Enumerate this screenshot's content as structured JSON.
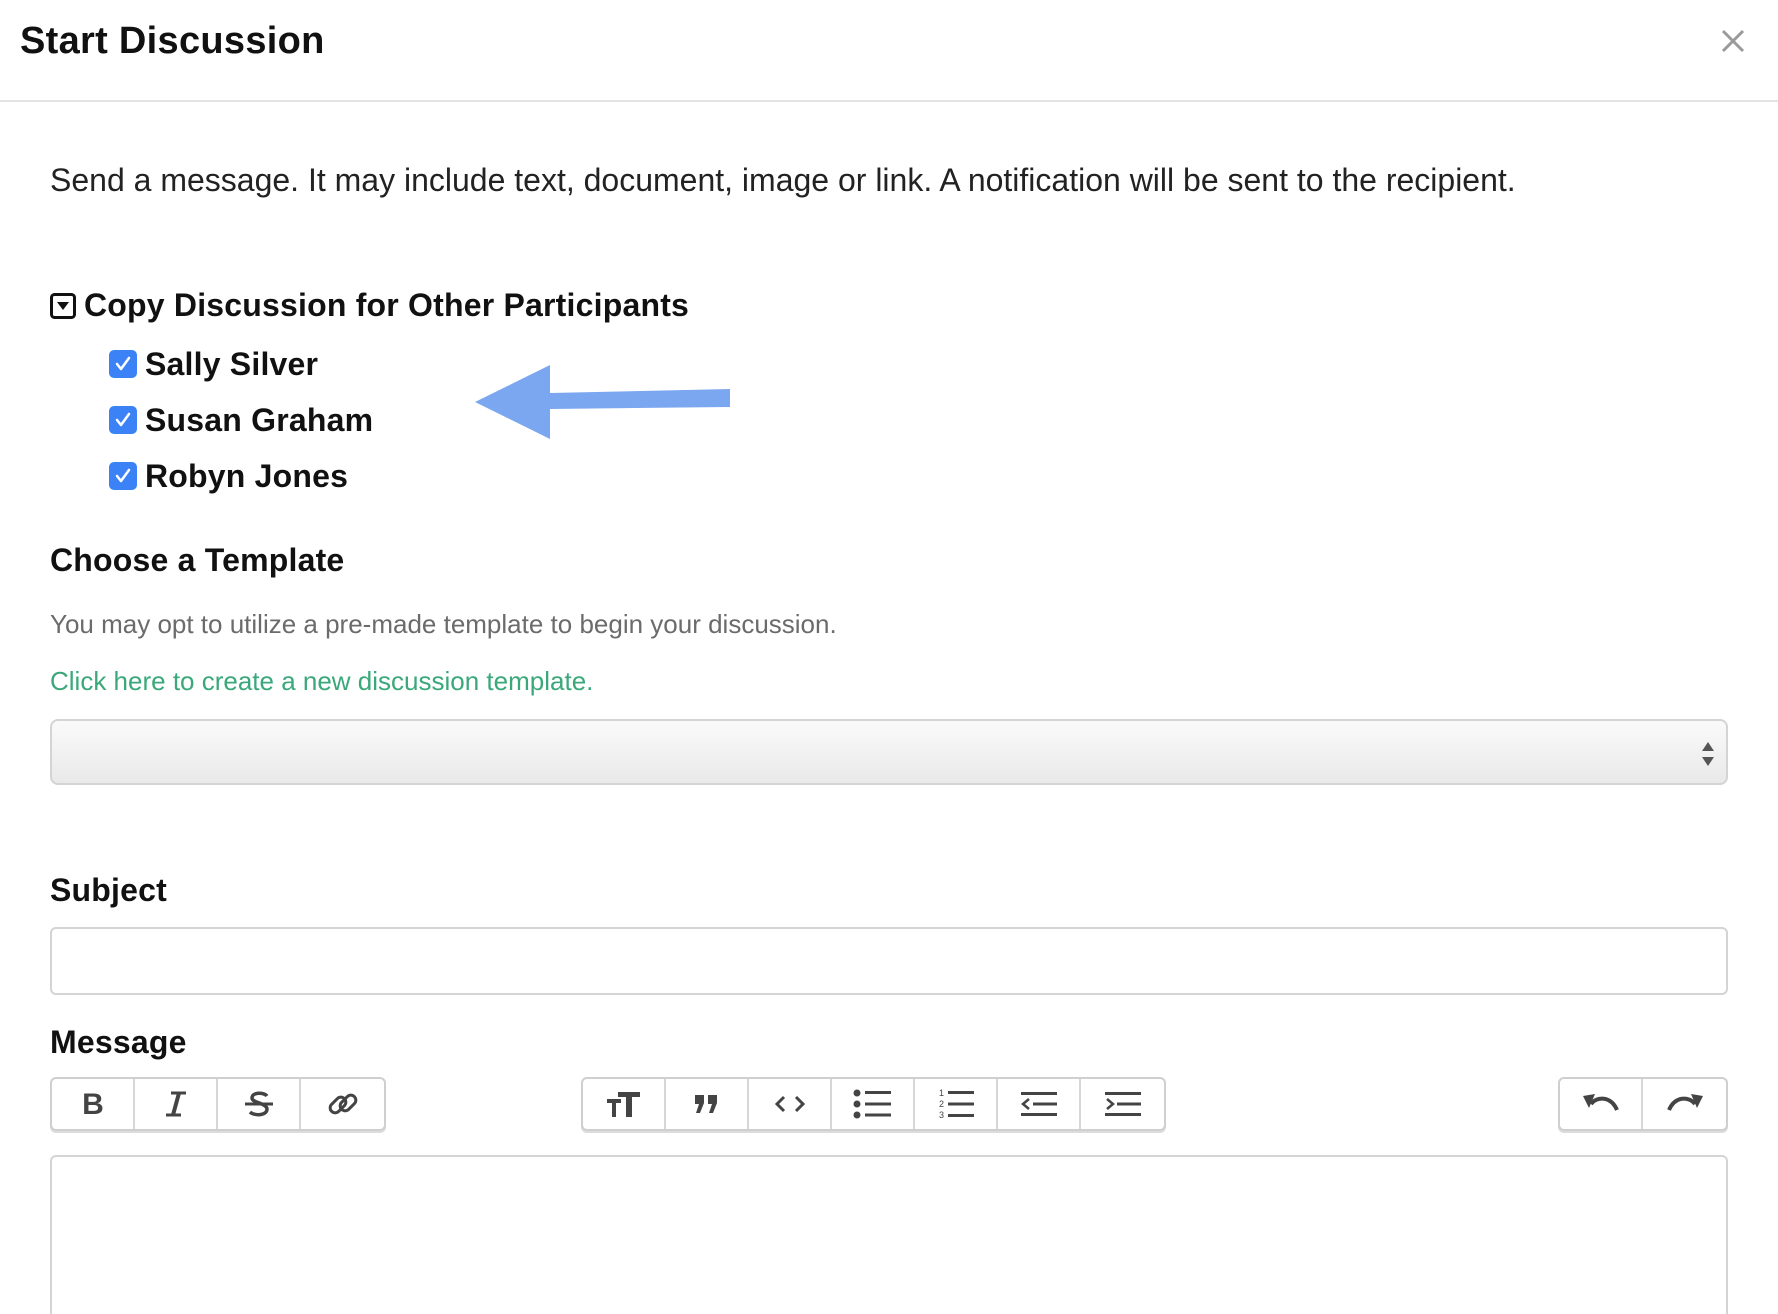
{
  "dialog": {
    "title": "Start Discussion",
    "close_icon": "close-icon"
  },
  "intro_text": "Send a message. It may include text, document, image or link. A notification will be sent to the recipient.",
  "copy_section": {
    "title": "Copy Discussion for Other Participants",
    "toggle_icon": "collapse-toggle-icon",
    "participants": [
      {
        "name": "Sally Silver",
        "checked": true
      },
      {
        "name": "Susan Graham",
        "checked": true
      },
      {
        "name": "Robyn Jones",
        "checked": true
      }
    ]
  },
  "annotation": {
    "icon": "arrow-left-icon",
    "color": "#7ba7f0"
  },
  "template": {
    "heading": "Choose a Template",
    "description": "You may opt to utilize a pre-made template to begin your discussion.",
    "link_text": "Click here to create a new discussion template.",
    "selected_value": ""
  },
  "subject": {
    "label": "Subject",
    "value": "",
    "placeholder": ""
  },
  "message": {
    "label": "Message",
    "value": "",
    "toolbar_groups": [
      [
        "bold-icon",
        "italic-icon",
        "strikethrough-icon",
        "link-icon"
      ],
      [
        "heading-icon",
        "quote-icon",
        "code-icon",
        "bullet-list-icon",
        "numbered-list-icon",
        "outdent-icon",
        "indent-icon"
      ],
      [
        "undo-icon",
        "redo-icon"
      ]
    ]
  },
  "colors": {
    "checkbox": "#3b82f6",
    "link": "#3aa87a",
    "arrow": "#7ba7f0"
  }
}
